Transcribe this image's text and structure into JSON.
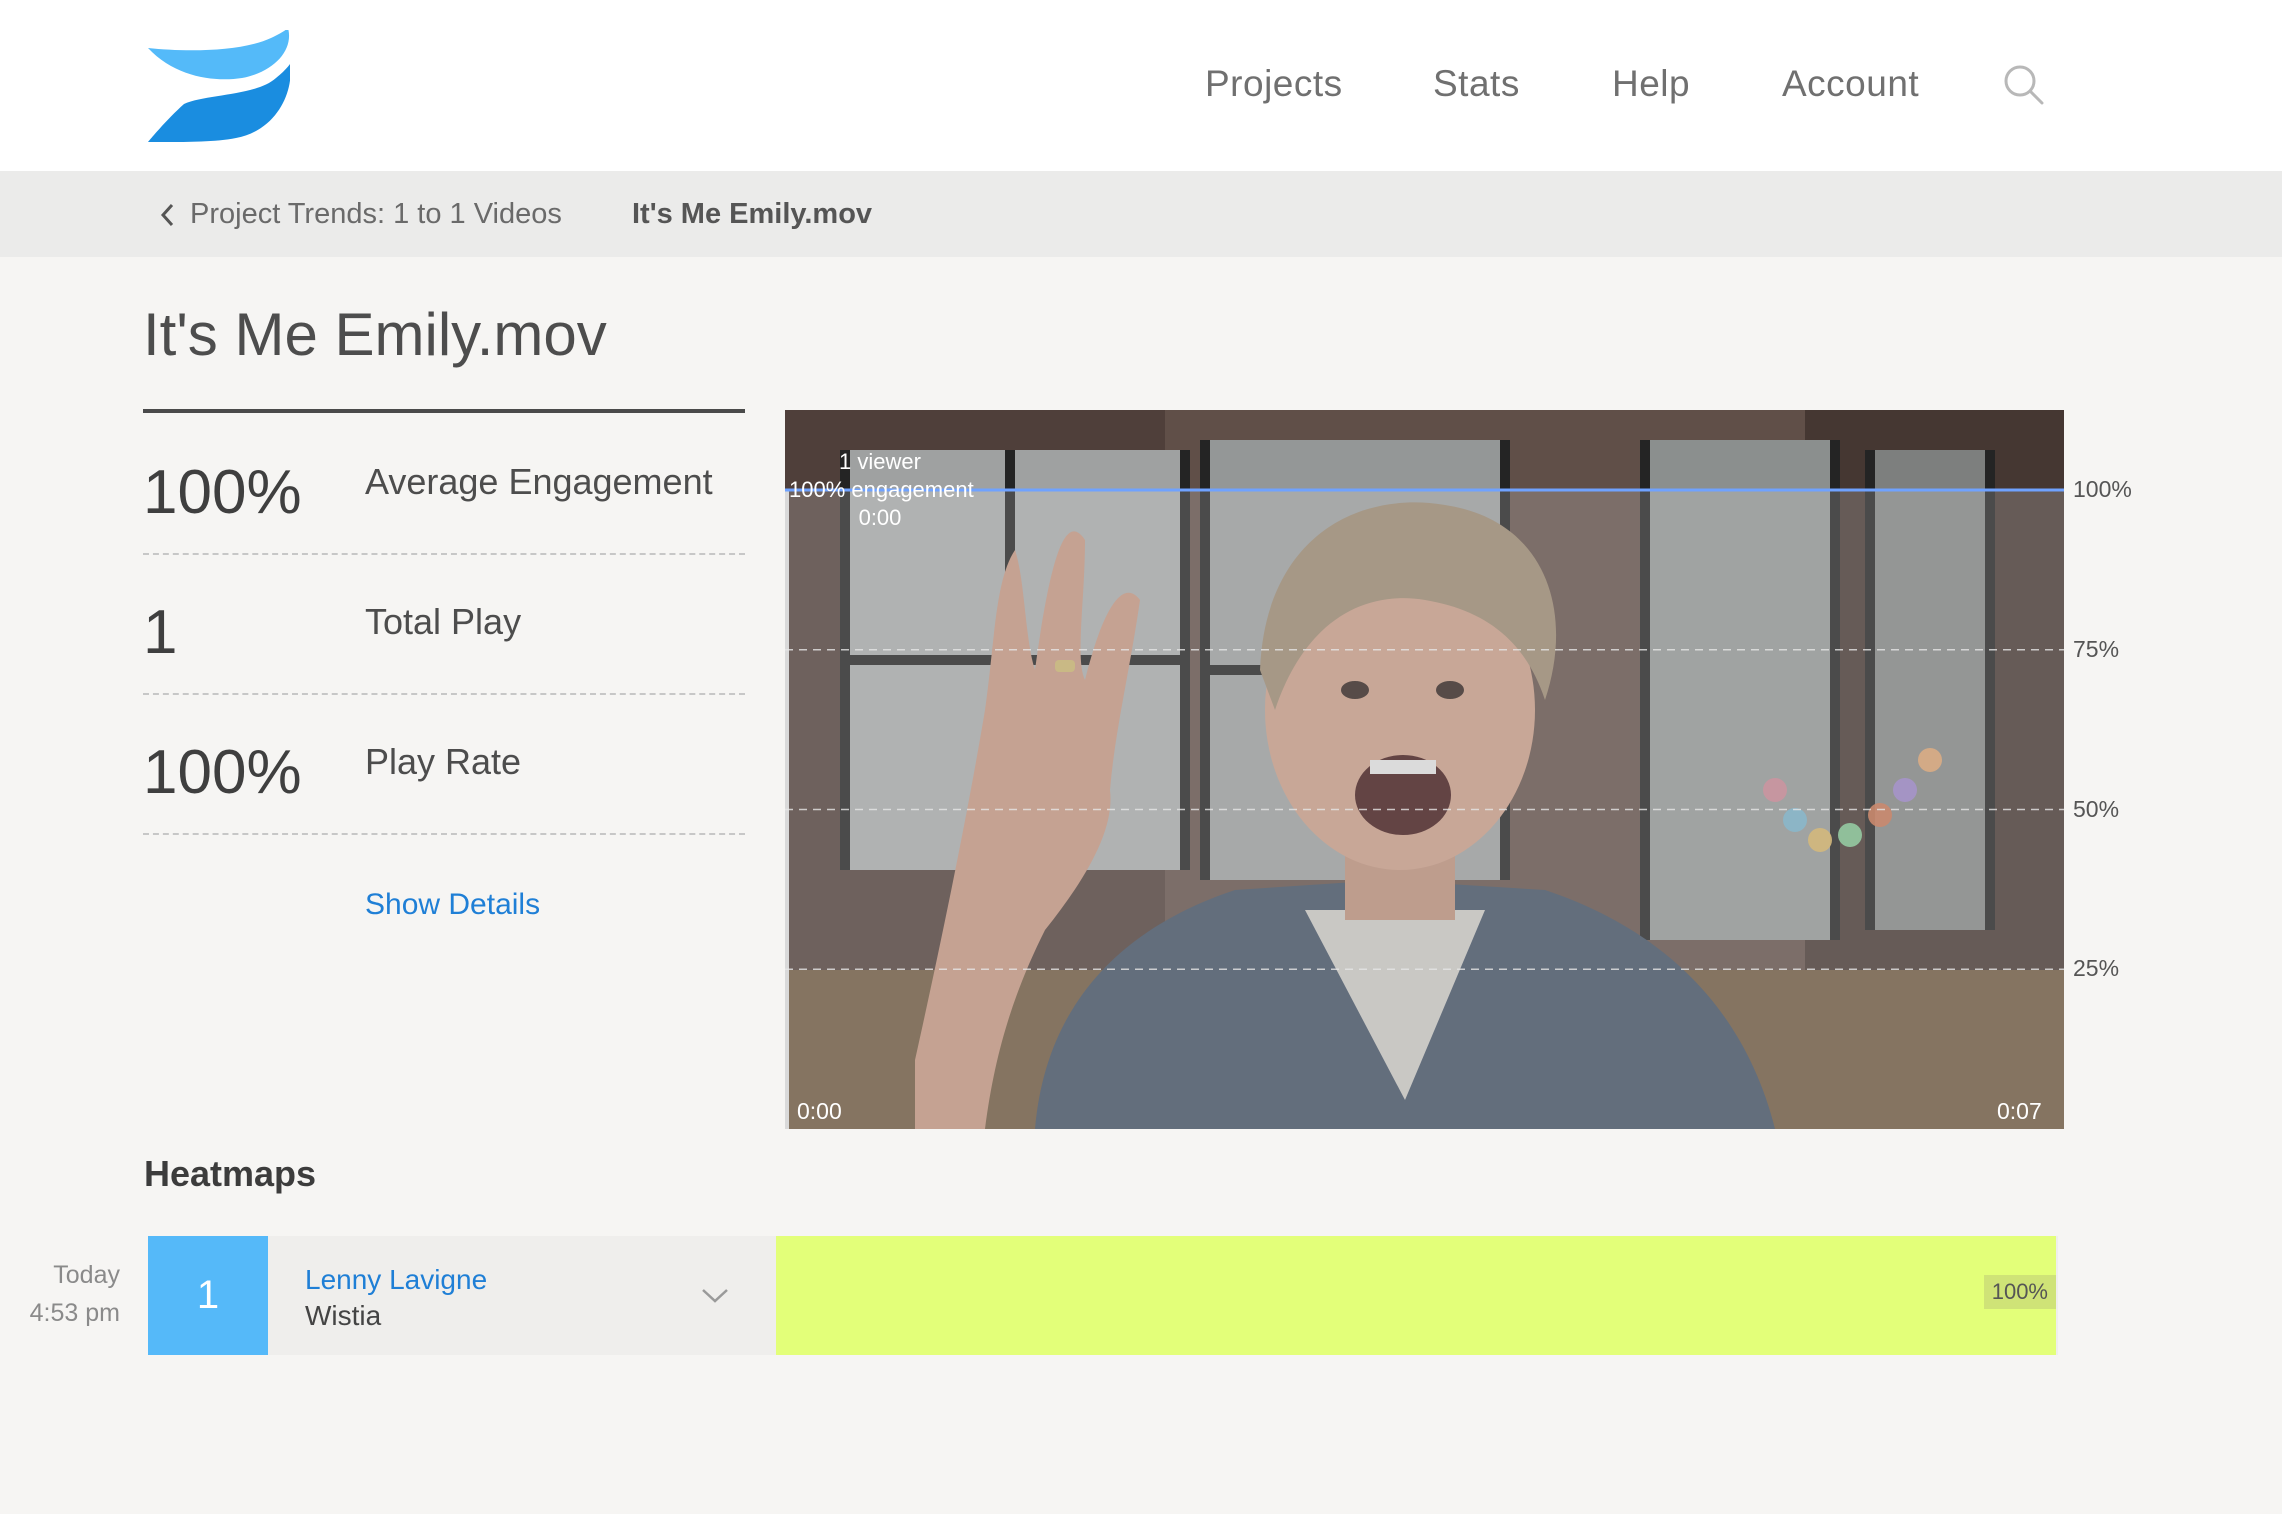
{
  "header": {
    "nav": [
      "Projects",
      "Stats",
      "Help",
      "Account"
    ]
  },
  "breadcrumb": {
    "back_label": "Project Trends: 1 to 1 Videos",
    "current": "It's Me Emily.mov"
  },
  "page": {
    "title": "It's Me Emily.mov"
  },
  "stats": [
    {
      "value": "100%",
      "label": "Average Engagement"
    },
    {
      "value": "1",
      "label": "Total Play"
    },
    {
      "value": "100%",
      "label": "Play Rate"
    }
  ],
  "show_details_label": "Show Details",
  "video": {
    "start_time": "0:00",
    "end_time": "0:07",
    "tooltip": {
      "viewers": "1 viewer",
      "engagement": "100% engagement",
      "time": "0:00"
    }
  },
  "chart_data": {
    "type": "line",
    "title": "",
    "xlabel": "",
    "ylabel": "",
    "x": [
      "0:00",
      "0:07"
    ],
    "series": [
      {
        "values": [
          100,
          100
        ]
      }
    ],
    "ylim": [
      0,
      100
    ],
    "yticks": [
      "100%",
      "75%",
      "50%",
      "25%"
    ],
    "ytick_values": [
      100,
      75,
      50,
      25
    ],
    "grid": true,
    "line_color": "#6fa2ff"
  },
  "heatmaps": {
    "heading": "Heatmaps",
    "rows": [
      {
        "date": "Today",
        "time": "4:53 pm",
        "count": "1",
        "viewer": "Lenny Lavigne",
        "org": "Wistia",
        "percent": "100%",
        "fill": 1.0
      }
    ]
  },
  "colors": {
    "accent": "#1f7fd6",
    "logo_light": "#54baf9",
    "logo_dark": "#1a8de0",
    "heat_fill": "#e3ff79",
    "count_badge": "#55b9f9"
  }
}
